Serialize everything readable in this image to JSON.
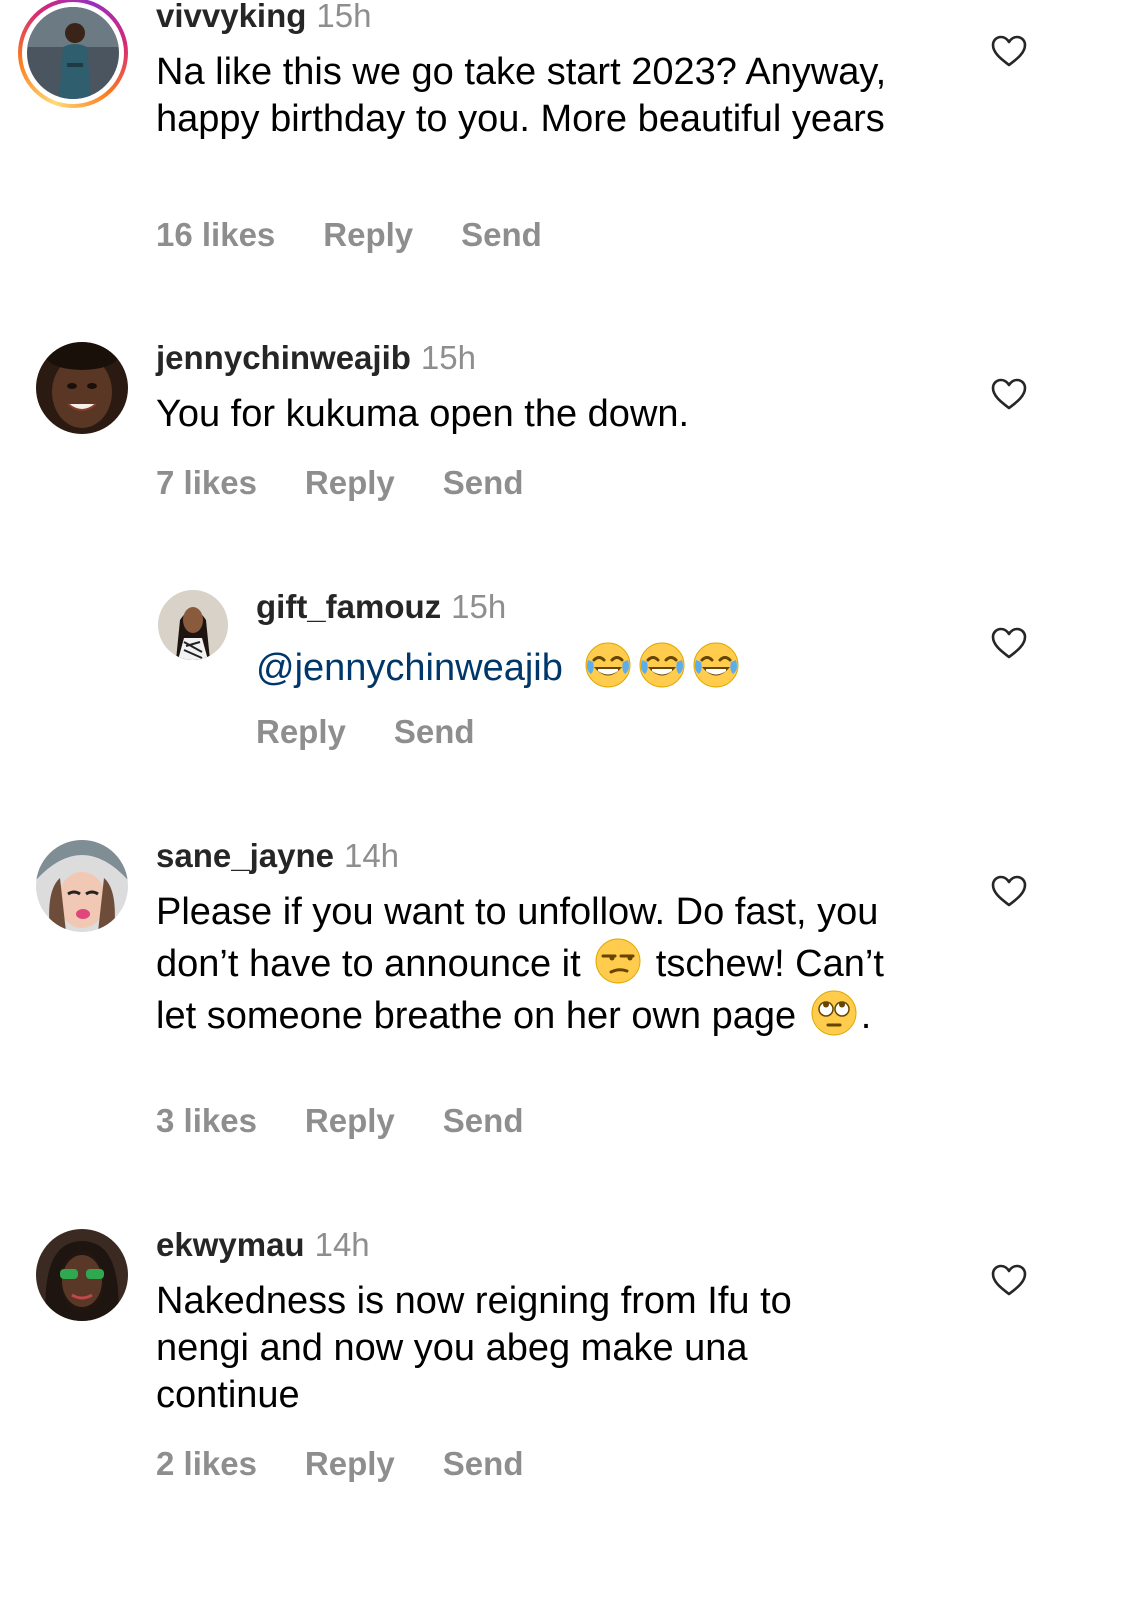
{
  "comments": [
    {
      "username": "vivvyking",
      "time": "15h",
      "text": "Na like this we go take start 2023? Anyway, happy birthday to you. More beautiful years",
      "likes": "16 likes",
      "reply": "Reply",
      "send": "Send",
      "has_story": true
    },
    {
      "username": "jennychinweajib",
      "time": "15h",
      "text": "You for kukuma open the down.",
      "likes": "7 likes",
      "reply": "Reply",
      "send": "Send"
    },
    {
      "username": "gift_famouz",
      "time": "15h",
      "mention": "@jennychinweajib",
      "emojis": [
        "face-with-tears-of-joy",
        "face-with-tears-of-joy",
        "face-with-tears-of-joy"
      ],
      "reply": "Reply",
      "send": "Send",
      "is_reply": true
    },
    {
      "username": "sane_jayne",
      "time": "14h",
      "text_part1": "Please if you want to unfollow. Do fast, you don’t have to announce it",
      "emoji1": "unamused-face",
      "text_part2": "tschew! Can’t let someone breathe on her own page",
      "emoji2": "face-with-rolling-eyes",
      "text_part3": ".",
      "likes": "3 likes",
      "reply": "Reply",
      "send": "Send"
    },
    {
      "username": "ekwymau",
      "time": "14h",
      "text": "Nakedness is now reigning from Ifu to nengi and now you abeg make una continue",
      "likes": "2 likes",
      "reply": "Reply",
      "send": "Send"
    }
  ],
  "icons": {
    "like": "heart-outline-icon"
  },
  "colors": {
    "username": "#262626",
    "muted": "#8e8e8e",
    "mention": "#00376b",
    "story_ring": [
      "#feda75",
      "#fa7e1e",
      "#d62976",
      "#962fbf"
    ]
  }
}
